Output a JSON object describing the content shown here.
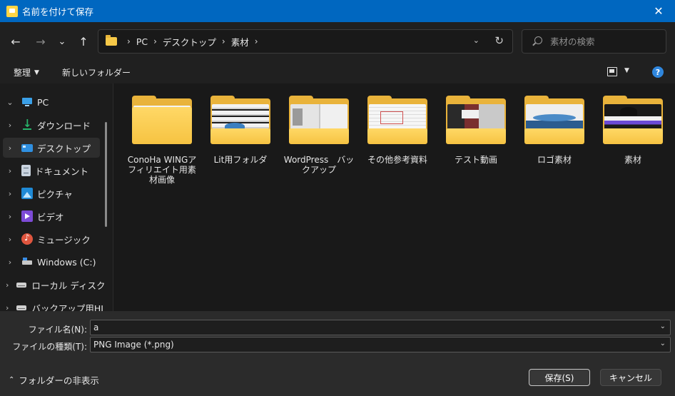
{
  "window": {
    "title": "名前を付けて保存",
    "close_symbol": "✕"
  },
  "nav": {
    "back": "←",
    "forward": "→",
    "recent": "⌄",
    "up": "↑"
  },
  "address": {
    "breadcrumbs": [
      "PC",
      "デスクトップ",
      "素材"
    ],
    "separator": "›",
    "dropdown": "⌄",
    "refresh": "↻"
  },
  "search": {
    "placeholder": "素材の検索"
  },
  "commandbar": {
    "organize": "整理",
    "new_folder": "新しいフォルダー",
    "help": "?"
  },
  "sidebar": {
    "items": [
      {
        "label": "PC",
        "icon": "pc-icon",
        "chevron": "⌄",
        "selected": false
      },
      {
        "label": "ダウンロード",
        "icon": "download-icon",
        "chevron": "›",
        "selected": false
      },
      {
        "label": "デスクトップ",
        "icon": "desktop-icon",
        "chevron": "›",
        "selected": true
      },
      {
        "label": "ドキュメント",
        "icon": "document-icon",
        "chevron": "›",
        "selected": false
      },
      {
        "label": "ピクチャ",
        "icon": "pictures-icon",
        "chevron": "›",
        "selected": false
      },
      {
        "label": "ビデオ",
        "icon": "video-icon",
        "chevron": "›",
        "selected": false
      },
      {
        "label": "ミュージック",
        "icon": "music-icon",
        "chevron": "›",
        "selected": false
      },
      {
        "label": "Windows (C:)",
        "icon": "drive-c-icon",
        "chevron": "›",
        "selected": false
      },
      {
        "label": "ローカル ディスク",
        "icon": "local-disk-icon",
        "chevron": "›",
        "selected": false
      },
      {
        "label": "バックアップ用HI",
        "icon": "backup-drive-icon",
        "chevron": "›",
        "selected": false
      }
    ]
  },
  "folders": [
    {
      "label": "ConoHa WINGアフィリエイト用素材画像",
      "thumbnail": "empty"
    },
    {
      "label": "Lit用フォルダ",
      "thumbnail": "lit"
    },
    {
      "label": "WordPress　バックアップ",
      "thumbnail": "wp"
    },
    {
      "label": "その他参考資料",
      "thumbnail": "other"
    },
    {
      "label": "テスト動画",
      "thumbnail": "video"
    },
    {
      "label": "ロゴ素材",
      "thumbnail": "logo"
    },
    {
      "label": "素材",
      "thumbnail": "sozai"
    }
  ],
  "form": {
    "filename_label": "ファイル名(N):",
    "filename_value": "a",
    "filetype_label": "ファイルの種類(T):",
    "filetype_value": "PNG Image (*.png)",
    "caret": "⌄"
  },
  "footer": {
    "hide_folders": "フォルダーの非表示",
    "hide_symbol": "⌃",
    "save": "保存(S)",
    "cancel": "キャンセル"
  },
  "colors": {
    "titlebar": "#0067c0",
    "folder": "#f6c342",
    "help": "#2f86dd"
  }
}
